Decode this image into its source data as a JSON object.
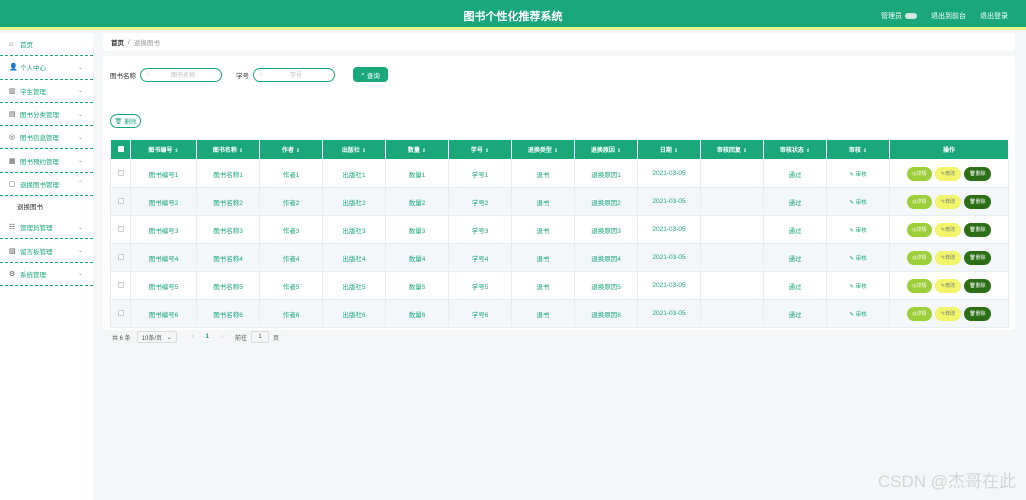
{
  "header": {
    "title": "图书个性化推荐系统",
    "role": "管理员",
    "links": [
      "退出到前台",
      "退出登录"
    ]
  },
  "sidebar": {
    "items": [
      {
        "label": "首页",
        "icon": "home-icon",
        "glyph": "⌂",
        "chev": ""
      },
      {
        "label": "个人中心",
        "icon": "user-icon",
        "glyph": "👤",
        "chev": "⌄"
      },
      {
        "label": "学生管理",
        "icon": "student-icon",
        "glyph": "▥",
        "chev": "⌄"
      },
      {
        "label": "图书分类管理",
        "icon": "category-icon",
        "glyph": "▤",
        "chev": "⌄"
      },
      {
        "label": "图书信息管理",
        "icon": "book-info-icon",
        "glyph": "◎",
        "chev": "⌄"
      },
      {
        "label": "图书预约管理",
        "icon": "reservation-icon",
        "glyph": "▦",
        "chev": "⌄"
      },
      {
        "label": "退换图书管理",
        "icon": "return-icon",
        "glyph": "▢",
        "chev": "⌃"
      }
    ],
    "submenu": "退换图书",
    "items_after": [
      {
        "label": "管理员管理",
        "icon": "admin-icon",
        "glyph": "☷",
        "chev": "⌄"
      },
      {
        "label": "留言板管理",
        "icon": "message-icon",
        "glyph": "▨",
        "chev": "⌄"
      },
      {
        "label": "系统管理",
        "icon": "settings-icon",
        "glyph": "⚙",
        "chev": "⌄"
      }
    ]
  },
  "breadcrumb": {
    "home": "首页",
    "sep": "/",
    "current": "退换图书"
  },
  "search": {
    "book_name_label": "图书名称",
    "book_name_placeholder": "图书名称",
    "student_no_label": "学号",
    "student_no_placeholder": "学号",
    "query_label": "查询"
  },
  "delete_label": "删除",
  "table": {
    "columns": [
      "图书编号",
      "图书名称",
      "作者",
      "出版社",
      "数量",
      "学号",
      "退换类型",
      "退换原因",
      "日期",
      "审核回复",
      "审核状态",
      "审核",
      "操作"
    ],
    "rows": [
      [
        "图书编号1",
        "图书名称1",
        "作者1",
        "出版社1",
        "数量1",
        "学号1",
        "退书",
        "退换原因1",
        "2021-03-05",
        "",
        "通过"
      ],
      [
        "图书编号2",
        "图书名称2",
        "作者2",
        "出版社2",
        "数量2",
        "学号2",
        "退书",
        "退换原因2",
        "2021-03-05",
        "",
        "通过"
      ],
      [
        "图书编号3",
        "图书名称3",
        "作者3",
        "出版社3",
        "数量3",
        "学号3",
        "退书",
        "退换原因3",
        "2021-03-05",
        "",
        "通过"
      ],
      [
        "图书编号4",
        "图书名称4",
        "作者4",
        "出版社4",
        "数量4",
        "学号4",
        "退书",
        "退换原因4",
        "2021-03-05",
        "",
        "通过"
      ],
      [
        "图书编号5",
        "图书名称5",
        "作者5",
        "出版社5",
        "数量5",
        "学号5",
        "退书",
        "退换原因5",
        "2021-03-05",
        "",
        "通过"
      ],
      [
        "图书编号6",
        "图书名称6",
        "作者6",
        "出版社6",
        "数量6",
        "学号6",
        "退书",
        "退换原因6",
        "2021-03-05",
        "",
        "通过"
      ]
    ],
    "review_label": "审核",
    "op_detail": "详情",
    "op_edit": "修改",
    "op_delete": "删除"
  },
  "pager": {
    "total": "共 6 条",
    "page_size": "10条/页",
    "current": "1",
    "goto": "前往",
    "goto_value": "1",
    "page_unit": "页"
  },
  "watermark": "CSDN @杰哥在此",
  "colors": {
    "primary": "#1aa87a",
    "accent_strip": "#e9f58a",
    "detail": "#9ccf3a",
    "edit": "#f2f56a",
    "delete": "#2c6e16"
  }
}
